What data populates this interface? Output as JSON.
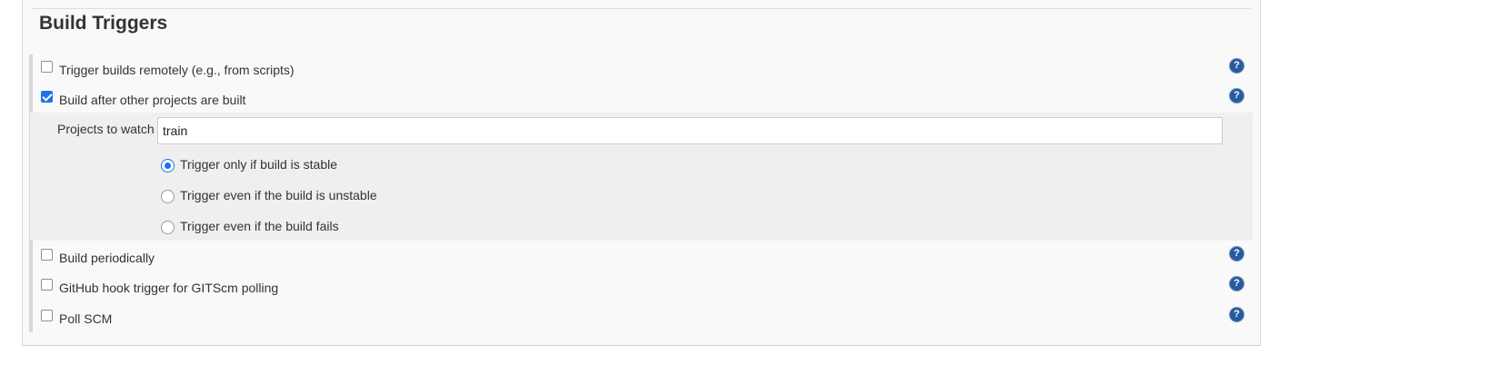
{
  "section": {
    "title": "Build Triggers"
  },
  "triggers": {
    "remote": {
      "label": "Trigger builds remotely (e.g., from scripts)",
      "checked": false
    },
    "after_other": {
      "label": "Build after other projects are built",
      "checked": true
    },
    "periodically": {
      "label": "Build periodically",
      "checked": false
    },
    "github_hook": {
      "label": "GitHub hook trigger for GITScm polling",
      "checked": false
    },
    "poll_scm": {
      "label": "Poll SCM",
      "checked": false
    }
  },
  "after_other_config": {
    "projects_label": "Projects to watch",
    "projects_value": "train",
    "options": [
      {
        "label": "Trigger only if build is stable",
        "selected": true
      },
      {
        "label": "Trigger even if the build is unstable",
        "selected": false
      },
      {
        "label": "Trigger even if the build fails",
        "selected": false
      }
    ]
  },
  "help_icon_glyph": "?",
  "colors": {
    "accent": "#1a73e8",
    "help_icon": "#2a5a9e",
    "panel_bg": "#f9f9f9",
    "nested_bg": "#efefef"
  }
}
